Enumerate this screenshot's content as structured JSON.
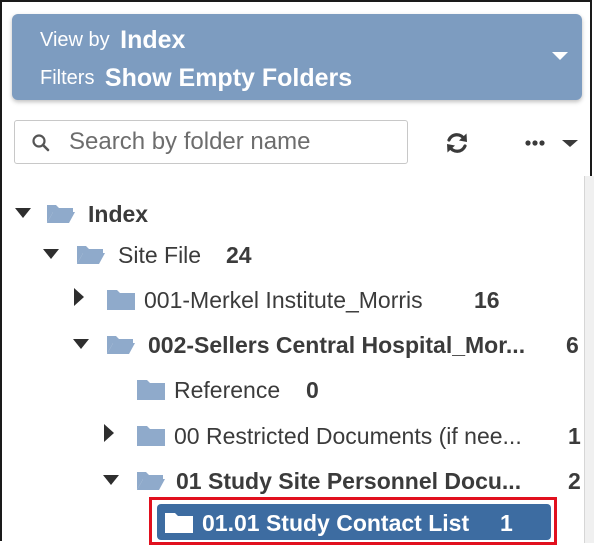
{
  "header": {
    "view_by_label": "View by",
    "view_by_value": "Index",
    "filters_label": "Filters",
    "filters_value": "Show Empty Folders"
  },
  "search": {
    "placeholder": "Search by folder name",
    "value": ""
  },
  "colors": {
    "header_bg": "#7d9cc0",
    "folder_icon": "#8faacb",
    "selected_bg": "#3d6ca1",
    "highlight_border": "#e1101e"
  },
  "tree": [
    {
      "name": "Index",
      "count": "",
      "expanded": true
    },
    {
      "name": "Site File",
      "count": "24",
      "expanded": true
    },
    {
      "name": "001-Merkel Institute_Morris",
      "count": "16",
      "expanded": false
    },
    {
      "name": "002-Sellers Central Hospital_Mor...",
      "count": "6",
      "expanded": true
    },
    {
      "name": "Reference",
      "count": "0",
      "expanded": null
    },
    {
      "name": "00 Restricted Documents (if nee...",
      "count": "1",
      "expanded": false
    },
    {
      "name": "01 Study Site Personnel Docu...",
      "count": "2",
      "expanded": true
    },
    {
      "name": "01.01 Study Contact List",
      "count": "1",
      "expanded": null,
      "selected": true
    }
  ]
}
